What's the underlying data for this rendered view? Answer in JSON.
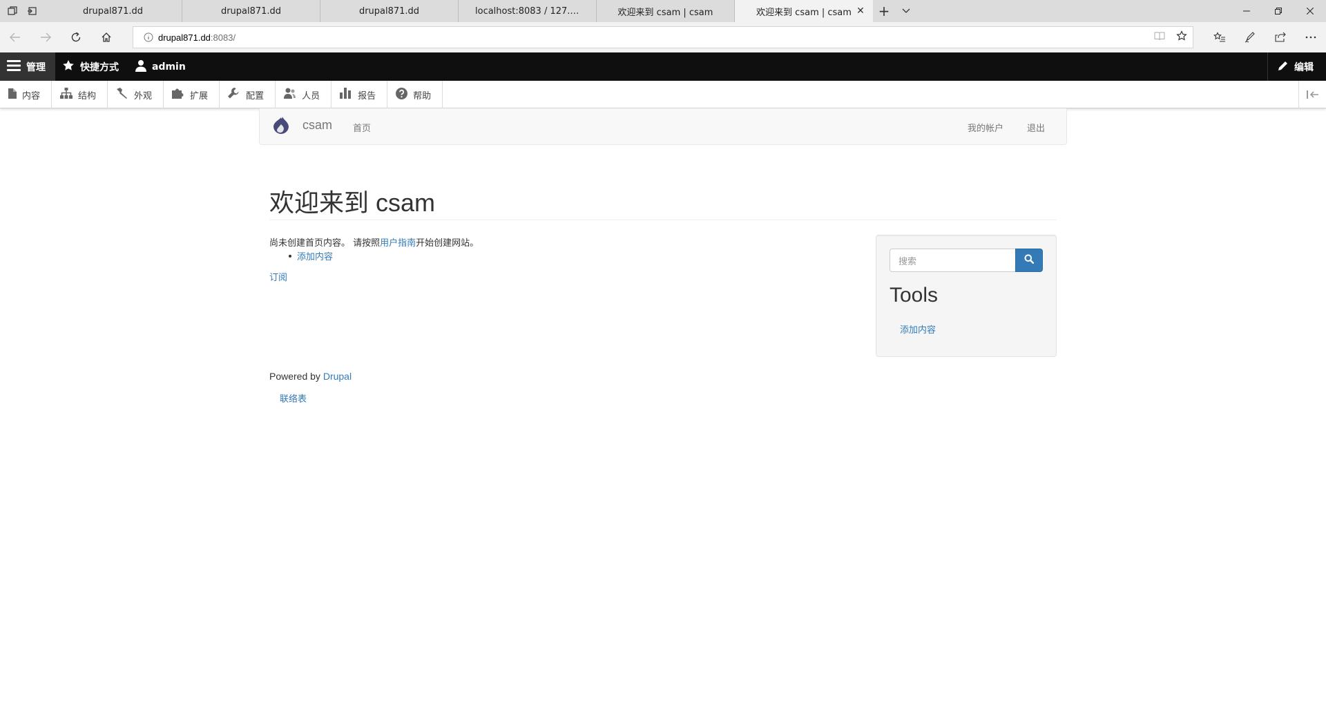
{
  "browser": {
    "tabs": [
      {
        "title": "drupal871.dd",
        "active": false
      },
      {
        "title": "drupal871.dd",
        "active": false
      },
      {
        "title": "drupal871.dd",
        "active": false
      },
      {
        "title": "localhost:8083 / 127.0.0.1 /",
        "active": false
      },
      {
        "title": "欢迎来到 csam | csam",
        "active": false
      },
      {
        "title": "欢迎来到 csam | csam",
        "active": true
      }
    ],
    "url_host": "drupal871.dd",
    "url_port": ":8083/"
  },
  "admin_toolbar": {
    "manage_label": "管理",
    "shortcuts_label": "快捷方式",
    "user_label": "admin",
    "edit_label": "编辑",
    "tray_items": [
      {
        "label": "内容",
        "icon": "file-icon"
      },
      {
        "label": "结构",
        "icon": "sitemap-icon"
      },
      {
        "label": "外观",
        "icon": "paintbrush-icon"
      },
      {
        "label": "扩展",
        "icon": "puzzle-icon"
      },
      {
        "label": "配置",
        "icon": "wrench-icon"
      },
      {
        "label": "人员",
        "icon": "people-icon"
      },
      {
        "label": "报告",
        "icon": "bar-chart-icon"
      },
      {
        "label": "帮助",
        "icon": "help-icon"
      }
    ]
  },
  "site_header": {
    "site_name": "csam",
    "home_link": "首页",
    "my_account": "我的帐户",
    "logout": "退出"
  },
  "main": {
    "title": "欢迎来到 csam",
    "empty_text_before": "尚未创建首页内容。 请按照",
    "user_guide_link": "用户指南",
    "empty_text_after": "开始创建网站。",
    "add_content_link": "添加内容",
    "feed_link": "订阅"
  },
  "sidebar": {
    "search_placeholder": "搜索",
    "tools_title": "Tools",
    "tools_link": "添加内容"
  },
  "footer": {
    "powered_by": "Powered by ",
    "drupal_link": "Drupal",
    "contact_link": "联络表"
  },
  "colors": {
    "link": "#337ab7",
    "toolbar_bg": "#0f0f0f",
    "search_button": "#337ab7"
  }
}
